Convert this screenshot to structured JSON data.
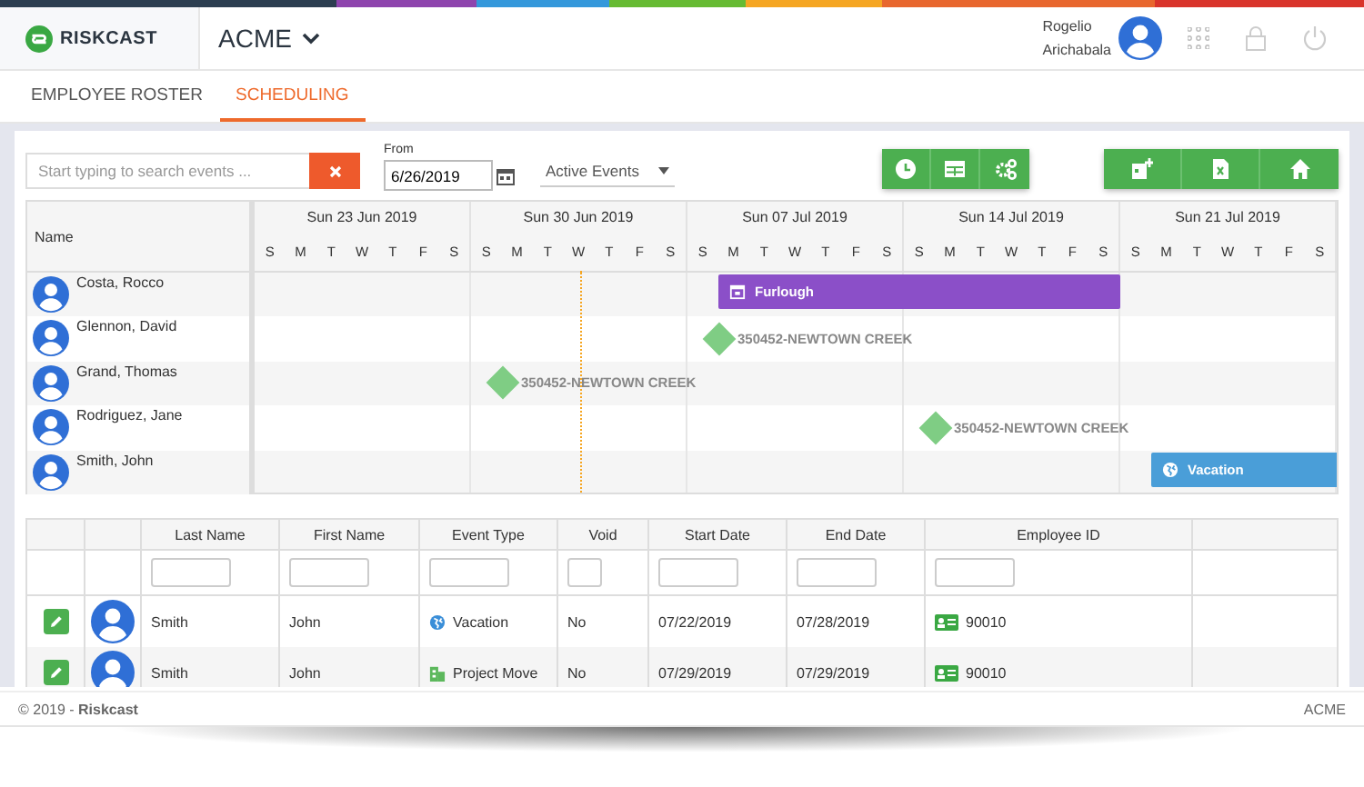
{
  "header": {
    "logo": "RISKCAST",
    "company": "ACME",
    "user": {
      "first": "Rogelio",
      "last": "Arichabala"
    }
  },
  "tabs": [
    {
      "label": "EMPLOYEE ROSTER",
      "selected": false
    },
    {
      "label": "SCHEDULING",
      "selected": true
    }
  ],
  "toolbar": {
    "search": {
      "placeholder": "Start typing to search events ..."
    },
    "from": {
      "label": "From",
      "value": "6/26/2019"
    },
    "filter": {
      "value": "Active Events"
    }
  },
  "scheduler": {
    "name_header": "Name",
    "weeks": [
      {
        "label": "Sun 23 Jun 2019",
        "days": [
          "S",
          "M",
          "T",
          "W",
          "T",
          "F",
          "S"
        ]
      },
      {
        "label": "Sun 30 Jun 2019",
        "days": [
          "S",
          "M",
          "T",
          "W",
          "T",
          "F",
          "S"
        ]
      },
      {
        "label": "Sun 07 Jul 2019",
        "days": [
          "S",
          "M",
          "T",
          "W",
          "T",
          "F",
          "S"
        ]
      },
      {
        "label": "Sun 14 Jul 2019",
        "days": [
          "S",
          "M",
          "T",
          "W",
          "T",
          "F",
          "S"
        ]
      },
      {
        "label": "Sun 21 Jul 2019",
        "days": [
          "S",
          "M",
          "T",
          "W",
          "T",
          "F",
          "S"
        ]
      }
    ],
    "employees": [
      {
        "name": "Costa, Rocco",
        "events": [
          {
            "kind": "furlough",
            "label": "Furlough"
          }
        ]
      },
      {
        "name": "Glennon, David",
        "events": [
          {
            "kind": "milestone",
            "label": "350452-NEWTOWN CREEK"
          }
        ]
      },
      {
        "name": "Grand, Thomas",
        "events": [
          {
            "kind": "milestone",
            "label": "350452-NEWTOWN CREEK"
          }
        ]
      },
      {
        "name": "Rodriguez, Jane",
        "events": [
          {
            "kind": "milestone",
            "label": "350452-NEWTOWN CREEK"
          }
        ]
      },
      {
        "name": "Smith, John",
        "events": [
          {
            "kind": "vacation",
            "label": "Vacation"
          }
        ]
      }
    ]
  },
  "grid": {
    "columns": [
      "Last Name",
      "First Name",
      "Event Type",
      "Void",
      "Start Date",
      "End Date",
      "Employee ID"
    ],
    "rows": [
      {
        "last_name": "Smith",
        "first_name": "John",
        "event_type": {
          "kind": "vacation",
          "label": "Vacation"
        },
        "void": "No",
        "start_date": "07/22/2019",
        "end_date": "07/28/2019",
        "employee_id": "90010"
      },
      {
        "last_name": "Smith",
        "first_name": "John",
        "event_type": {
          "kind": "project",
          "label": "Project Move"
        },
        "void": "No",
        "start_date": "07/29/2019",
        "end_date": "07/29/2019",
        "employee_id": "90010"
      }
    ]
  },
  "footer": {
    "copyright": "© 2019 - **Riskcast**",
    "company": "ACME"
  }
}
